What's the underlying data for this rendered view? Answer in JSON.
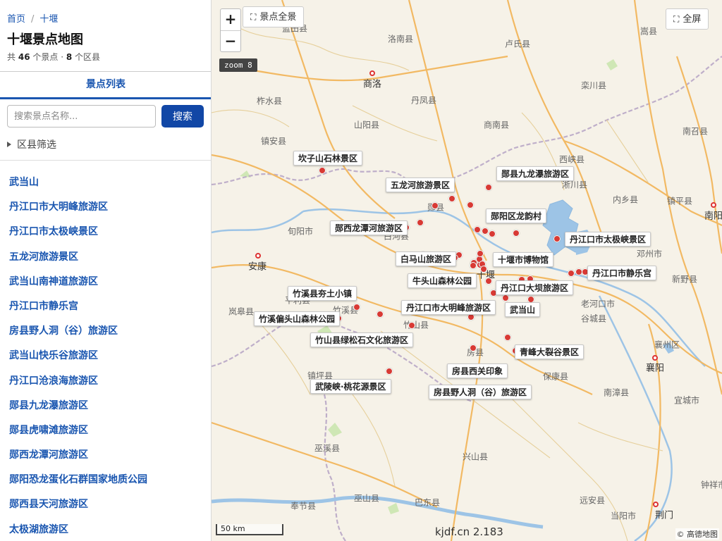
{
  "breadcrumb": {
    "home": "首页",
    "separator": "/",
    "current": "十堰"
  },
  "page": {
    "title": "十堰景点地图",
    "summary_prefix": "共",
    "spot_count": "46",
    "summary_mid": "个景点 ·",
    "district_count": "8",
    "summary_suffix": "个区县"
  },
  "tab": {
    "label": "景点列表"
  },
  "search": {
    "placeholder": "搜索景点名称...",
    "button": "搜索"
  },
  "filter": {
    "label": "区县筛选"
  },
  "spot_list": [
    "武当山",
    "丹江口市大明峰旅游区",
    "丹江口市太极峡景区",
    "五龙河旅游景区",
    "武当山南神道旅游区",
    "丹江口市静乐宫",
    "房县野人洞（谷）旅游区",
    "武当山快乐谷旅游区",
    "丹江口沧浪海旅游区",
    "郧县九龙瀑旅游区",
    "郧县虎啸滩旅游区",
    "郧西龙潭河旅游区",
    "郧阳恐龙蛋化石群国家地质公园",
    "郧西县天河旅游区",
    "太极湖旅游区"
  ],
  "map": {
    "zoom_in": "+",
    "zoom_out": "−",
    "overview_button": "景点全景",
    "fullscreen_button": "全屏",
    "zoom_label": "zoom 8",
    "scale_label": "50 km",
    "watermark": "kjdf.cn 2.183",
    "attribution": "© 高德地图",
    "colors": {
      "marker": "#d83a34",
      "road": "#f0b15c",
      "water": "#9dc4e6",
      "accent": "#1147a6"
    },
    "cities": [
      "商洛",
      "安康",
      "十堰",
      "襄阳",
      "南阳",
      "荆门"
    ],
    "towns": [
      "蓝田县",
      "洛南县",
      "卢氏县",
      "嵩县",
      "丹凤县",
      "柞水县",
      "栾川县",
      "山阳县",
      "商南县",
      "南召县",
      "镇安县",
      "西峡县",
      "淅川县",
      "内乡县",
      "镇平县",
      "郧县",
      "旬阳市",
      "白河县",
      "邓州市",
      "岚皋县",
      "平利县",
      "竹溪县",
      "竹山县",
      "老河口市",
      "谷城县",
      "新野县",
      "房县",
      "保康县",
      "南漳县",
      "宜城市",
      "镇坪县",
      "巫溪县",
      "兴山县",
      "巫山县",
      "巴东县",
      "奉节县",
      "远安县",
      "当阳市",
      "钟祥市",
      "襄州区"
    ],
    "spots": [
      "坎子山石林景区",
      "五龙河旅游景区",
      "郧县九龙瀑旅游区",
      "郧阳区龙韵村",
      "郧西龙潭河旅游区",
      "丹江口市太极峡景区",
      "白马山旅游区",
      "十堰市博物馆",
      "丹江口市静乐宫",
      "牛头山森林公园",
      "丹江口大坝旅游区",
      "竹溪县夯土小镇",
      "丹江口市大明峰旅游区",
      "武当山",
      "竹溪偏头山森林公园",
      "竹山县绿松石文化旅游区",
      "青峰大裂谷景区",
      "房县西关印象",
      "武陵峡·桃花源景区",
      "房县野人洞（谷）旅游区"
    ]
  }
}
